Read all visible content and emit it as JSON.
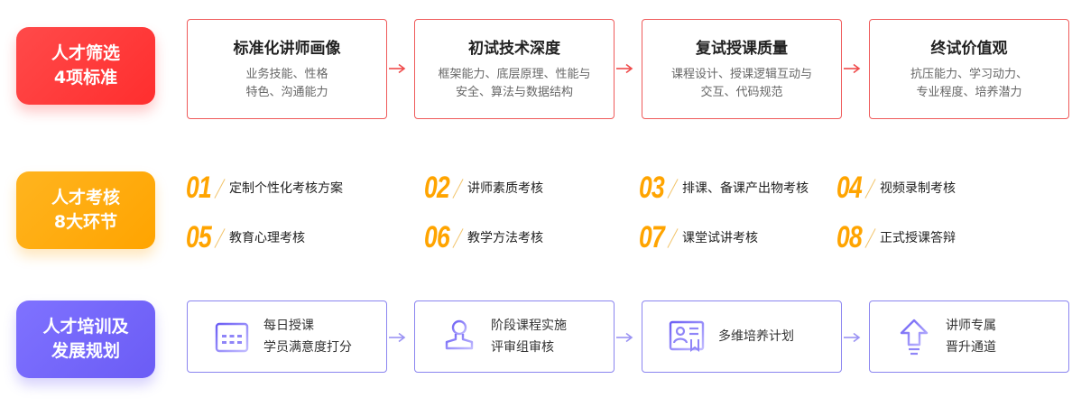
{
  "badges": [
    {
      "line1": "人才筛选",
      "line2": "4项标准",
      "color": "#ff3b3b"
    },
    {
      "line1": "人才考核",
      "line2": "8大环节",
      "color": "#ffa400"
    },
    {
      "line1": "人才培训及",
      "line2": "发展规划",
      "color": "#7366f8"
    }
  ],
  "screening": [
    {
      "title": "标准化讲师画像",
      "desc1": "业务技能、性格",
      "desc2": "特色、沟通能力"
    },
    {
      "title": "初试技术深度",
      "desc1": "框架能力、底层原理、性能与",
      "desc2": "安全、算法与数据结构"
    },
    {
      "title": "复试授课质量",
      "desc1": "课程设计、授课逻辑互动与",
      "desc2": "交互、代码规范"
    },
    {
      "title": "终试价值观",
      "desc1": "抗压能力、学习动力、",
      "desc2": "专业程度、培养潜力"
    }
  ],
  "assessment": [
    {
      "num": "01",
      "text": "定制个性化考核方案"
    },
    {
      "num": "02",
      "text": "讲师素质考核"
    },
    {
      "num": "03",
      "text": "排课、备课产出物考核"
    },
    {
      "num": "04",
      "text": "视频录制考核"
    },
    {
      "num": "05",
      "text": "教育心理考核"
    },
    {
      "num": "06",
      "text": "教学方法考核"
    },
    {
      "num": "07",
      "text": "课堂试讲考核"
    },
    {
      "num": "08",
      "text": "正式授课答辩"
    }
  ],
  "training": [
    {
      "icon": "calendar-icon",
      "line1": "每日授课",
      "line2": "学员满意度打分"
    },
    {
      "icon": "stamp-icon",
      "line1": "阶段课程实施",
      "line2": "评审组审核"
    },
    {
      "icon": "certificate-icon",
      "line1": "多维培养计划",
      "line2": ""
    },
    {
      "icon": "upgrade-arrow-icon",
      "line1": "讲师专属",
      "line2": "晋升通道"
    }
  ]
}
